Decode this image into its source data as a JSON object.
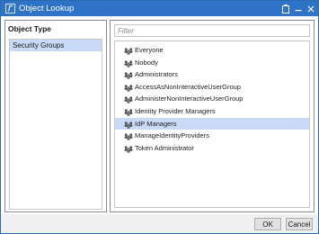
{
  "window": {
    "title": "Object Lookup",
    "accent": "#2f73c9",
    "selection_color": "#c9daf6"
  },
  "left_panel": {
    "header": "Object Type",
    "items": [
      {
        "label": "Security Groups",
        "selected": true
      }
    ]
  },
  "right_panel": {
    "filter_placeholder": "Filter",
    "filter_value": "",
    "items": [
      {
        "label": "Everyone",
        "icon": "group-icon"
      },
      {
        "label": "Nobody",
        "icon": "group-icon"
      },
      {
        "label": "Administrators",
        "icon": "group-icon"
      },
      {
        "label": "AccessAsNonInteractiveUserGroup",
        "icon": "group-icon"
      },
      {
        "label": "AdministerNonInteractiveUserGroup",
        "icon": "group-icon"
      },
      {
        "label": "Identity Provider Managers",
        "icon": "group-icon"
      },
      {
        "label": "IdP Managers",
        "icon": "group-icon",
        "selected": true
      },
      {
        "label": "ManageIdentityProviders",
        "icon": "group-icon"
      },
      {
        "label": "Token Administrator",
        "icon": "group-icon"
      }
    ]
  },
  "footer": {
    "ok_label": "OK",
    "cancel_label": "Cancel"
  }
}
